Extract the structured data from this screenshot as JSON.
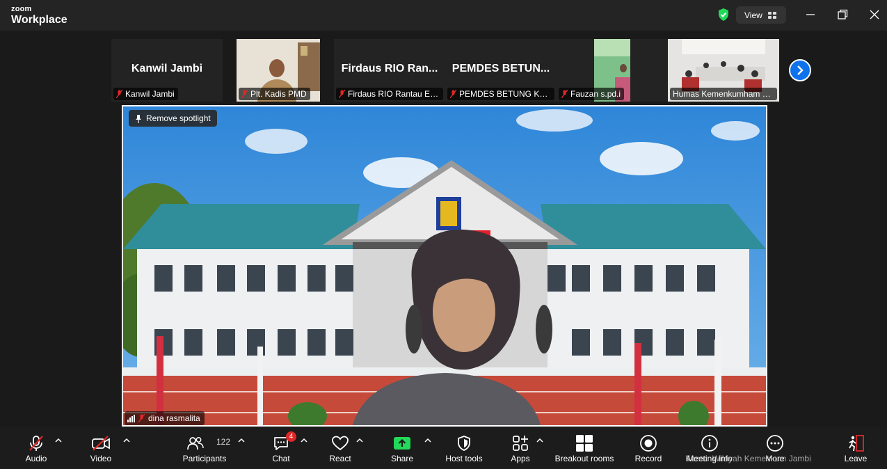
{
  "app": {
    "brand_top": "zoom",
    "brand_main": "Workplace"
  },
  "titlebar": {
    "view_label": "View"
  },
  "thumbnails": [
    {
      "title": "Kanwil Jambi",
      "name": "Kanwil Jambi"
    },
    {
      "title": "",
      "name": "Plt. Kadis PMD"
    },
    {
      "title": "Firdaus RIO Ran...",
      "name": "Firdaus RIO Rantau Em..."
    },
    {
      "title": "PEMDES BETUN...",
      "name": "PEMDES BETUNG KUN..."
    },
    {
      "title": "",
      "name": "Fauzan s.pd.i"
    },
    {
      "title": "",
      "name": "Humas Kemenkumham Ja..."
    }
  ],
  "main_video": {
    "spotlight_label": "Remove spotlight",
    "speaker_name": "dina rasmalita"
  },
  "toolbar": {
    "audio": "Audio",
    "video": "Video",
    "participants": "Participants",
    "participants_count": "122",
    "chat": "Chat",
    "chat_badge": "4",
    "react": "React",
    "share": "Share",
    "host_tools": "Host tools",
    "apps": "Apps",
    "breakout_rooms": "Breakout rooms",
    "record": "Record",
    "meeting_info": "Meeting info",
    "more": "More",
    "leave": "Leave"
  },
  "watermark": "Kantor Wilayah Kemenkum Jambi",
  "colors": {
    "accent": "#0e72ed",
    "share": "#23d959",
    "leave": "#e02828",
    "muted": "#e02828"
  }
}
